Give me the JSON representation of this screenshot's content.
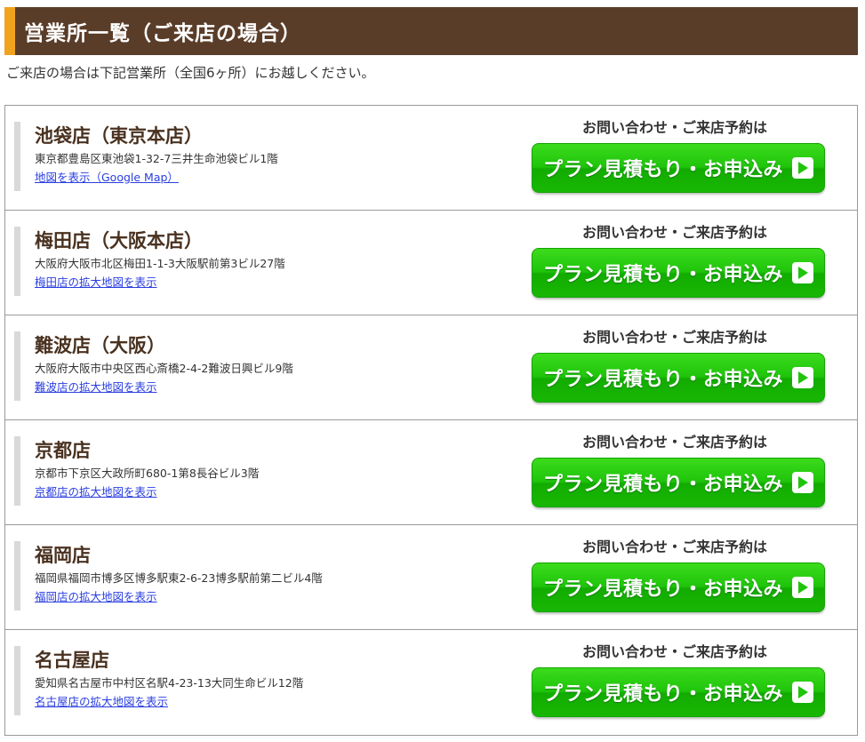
{
  "header": {
    "title": "営業所一覧（ご来店の場合）"
  },
  "intro": {
    "text": "ご来店の場合は下記営業所（全国6ヶ所）にお越しください。"
  },
  "contact": {
    "caption": "お問い合わせ・ご来店予約は",
    "button_label": "プラン見積もり・お申込み"
  },
  "offices": [
    {
      "name": "池袋店（東京本店）",
      "address": "東京都豊島区東池袋1-32-7三井生命池袋ビル1階",
      "map_link": "地図を表示（Google Map）"
    },
    {
      "name": "梅田店（大阪本店）",
      "address": "大阪府大阪市北区梅田1-1-3大阪駅前第3ビル27階",
      "map_link": "梅田店の拡大地図を表示"
    },
    {
      "name": "難波店（大阪）",
      "address": "大阪府大阪市中央区西心斎橋2-4-2難波日興ビル9階",
      "map_link": "難波店の拡大地図を表示"
    },
    {
      "name": "京都店",
      "address": "京都市下京区大政所町680-1第8長谷ビル3階",
      "map_link": "京都店の拡大地図を表示"
    },
    {
      "name": "福岡店",
      "address": "福岡県福岡市博多区博多駅東2-6-23博多駅前第二ビル4階",
      "map_link": "福岡店の拡大地図を表示"
    },
    {
      "name": "名古屋店",
      "address": "愛知県名古屋市中村区名駅4-23-13大同生命ビル12階",
      "map_link": "名古屋店の拡大地図を表示"
    }
  ],
  "colors": {
    "header_bg": "#5a3d29",
    "header_accent": "#f0a31f",
    "button_green": "#1fc40b",
    "link_blue": "#2a3ee0"
  },
  "icons": {
    "button_icon": "play-icon"
  }
}
